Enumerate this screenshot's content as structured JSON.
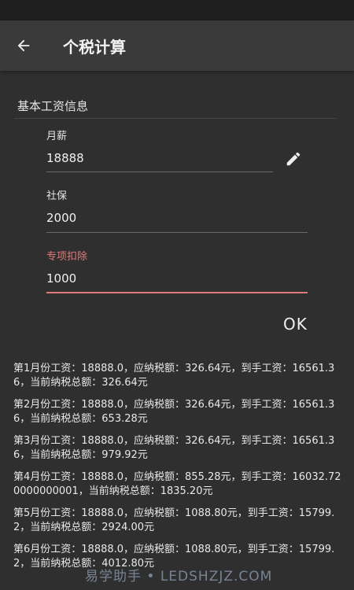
{
  "appbar": {
    "title": "个税计算"
  },
  "section": {
    "title": "基本工资信息"
  },
  "fields": {
    "salary": {
      "label": "月薪",
      "value": "18888"
    },
    "social": {
      "label": "社保",
      "value": "2000"
    },
    "deduction": {
      "label": "专项扣除",
      "value": "1000"
    }
  },
  "actions": {
    "ok_label": "OK"
  },
  "results": [
    "第1月份工资：18888.0，应纳税额：326.64元，到手工资：16561.36，当前纳税总额：326.64元",
    "第2月份工资：18888.0，应纳税额：326.64元，到手工资：16561.36，当前纳税总额：653.28元",
    "第3月份工资：18888.0，应纳税额：326.64元，到手工资：16561.36，当前纳税总额：979.92元",
    "第4月份工资：18888.0，应纳税额：855.28元，到手工资：16032.720000000001，当前纳税总额：1835.20元",
    "第5月份工资：18888.0，应纳税额：1088.80元，到手工资：15799.2，当前纳税总额：2924.00元",
    "第6月份工资：18888.0，应纳税额：1088.80元，到手工资：15799.2，当前纳税总额：4012.80元"
  ],
  "watermark": "易学助手 • LEDSHZJZ.COM",
  "icons": {
    "back": "arrow-back-icon",
    "edit": "pencil-icon"
  },
  "colors": {
    "accent": "#e07a7a",
    "appbar": "#3a3a3a",
    "background": "#2f2f2f"
  }
}
